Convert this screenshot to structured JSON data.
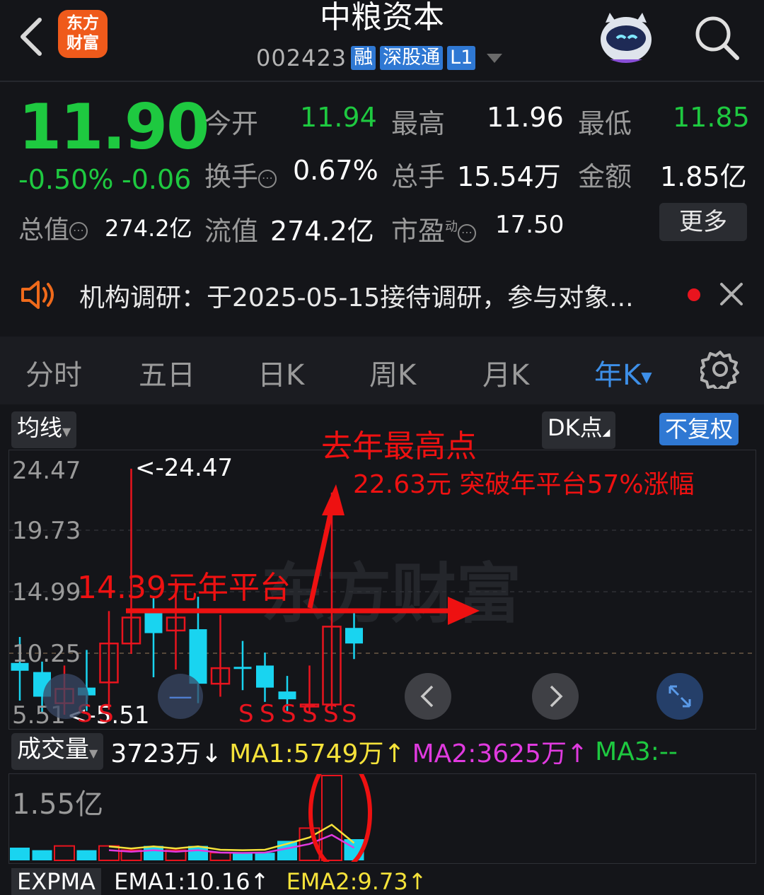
{
  "header": {
    "title": "中粮资本",
    "logo_line1": "东方",
    "logo_line2": "财富",
    "code": "002423",
    "tags": [
      "融",
      "深股通",
      "L1"
    ]
  },
  "quote": {
    "price": "11.90",
    "change_pct": "-0.50%",
    "change_amt": "-0.06",
    "fields": {
      "open_label": "今开",
      "open_value": "11.94",
      "high_label": "最高",
      "high_value": "11.96",
      "low_label": "最低",
      "low_value": "11.85",
      "turnover_label": "换手",
      "turnover_value": "0.67%",
      "volume_label": "总手",
      "volume_value": "15.54万",
      "amount_label": "金额",
      "amount_value": "1.85亿",
      "mktcap_label": "总值",
      "mktcap_value": "274.2亿",
      "float_label": "流值",
      "float_value": "274.2亿",
      "pe_label": "市盈",
      "pe_sup": "动",
      "pe_value": "17.50"
    },
    "more_label": "更多"
  },
  "news": {
    "text": "机构调研：于2025-05-15接待调研，参与对象..."
  },
  "tabs": [
    {
      "label": "分时"
    },
    {
      "label": "五日"
    },
    {
      "label": "日K"
    },
    {
      "label": "周K"
    },
    {
      "label": "月K"
    },
    {
      "label": "年K"
    }
  ],
  "chart_toolbar": {
    "ma_label": "均线",
    "dk_label": "DK点",
    "adjust_label": "不复权"
  },
  "chart_data": {
    "type": "candlestick",
    "y_ticks": [
      "24.47",
      "19.73",
      "14.99",
      "10.25",
      "5.51"
    ],
    "ylim": [
      5.51,
      24.47
    ],
    "max_label": "<-24.47",
    "min_label": "<-5.51",
    "watermark": "东方财富",
    "candles": [
      {
        "o": 9.5,
        "c": 8.9,
        "h": 11.5,
        "l": 6.6,
        "dir": "down"
      },
      {
        "o": 8.8,
        "c": 6.9,
        "h": 9.6,
        "l": 5.7,
        "dir": "down"
      },
      {
        "o": 6.4,
        "c": 7.5,
        "h": 9.3,
        "l": 5.51,
        "dir": "up"
      },
      {
        "o": 7.6,
        "c": 7.0,
        "h": 10.5,
        "l": 5.8,
        "dir": "down"
      },
      {
        "o": 8.0,
        "c": 11.0,
        "h": 13.5,
        "l": 5.9,
        "dir": "up"
      },
      {
        "o": 11.0,
        "c": 13.0,
        "h": 24.47,
        "l": 10.2,
        "dir": "up"
      },
      {
        "o": 13.4,
        "c": 11.8,
        "h": 14.6,
        "l": 8.4,
        "dir": "down"
      },
      {
        "o": 12.0,
        "c": 13.0,
        "h": 16.0,
        "l": 9.0,
        "dir": "up"
      },
      {
        "o": 12.1,
        "c": 7.9,
        "h": 14.6,
        "l": 6.4,
        "dir": "down"
      },
      {
        "o": 7.9,
        "c": 9.1,
        "h": 13.2,
        "l": 6.9,
        "dir": "up"
      },
      {
        "o": 9.2,
        "c": 9.1,
        "h": 11.2,
        "l": 7.4,
        "dir": "down"
      },
      {
        "o": 9.3,
        "c": 7.6,
        "h": 10.3,
        "l": 6.5,
        "dir": "down"
      },
      {
        "o": 7.3,
        "c": 6.7,
        "h": 8.5,
        "l": 5.8,
        "dir": "down"
      },
      {
        "o": 6.2,
        "c": 6.3,
        "h": 9.3,
        "l": 5.6,
        "dir": "up"
      },
      {
        "o": 6.3,
        "c": 12.3,
        "h": 22.63,
        "l": 5.9,
        "dir": "up"
      },
      {
        "o": 12.2,
        "c": 11.0,
        "h": 13.4,
        "l": 9.8,
        "dir": "down"
      }
    ],
    "signal_label": "S",
    "annotations": {
      "platform": "14.39元年平台",
      "peak_title": "去年最高点",
      "peak_detail": "22.63元 突破年平台57%涨幅"
    },
    "volume": {
      "label": "成交量",
      "current": "3723万",
      "current_arrow": "↓",
      "ma1": "MA1:5749万",
      "ma1_arrow": "↑",
      "ma2": "MA2:3625万",
      "ma2_arrow": "↑",
      "ma3": "MA3:--",
      "max_label": "1.55亿",
      "bars": [
        0.15,
        0.12,
        0.17,
        0.12,
        0.17,
        0.12,
        0.17,
        0.12,
        0.17,
        0.09,
        0.08,
        0.09,
        0.23,
        0.38,
        1.0,
        0.25
      ],
      "bar_dirs": [
        "down",
        "down",
        "up",
        "down",
        "up",
        "up",
        "down",
        "up",
        "down",
        "up",
        "down",
        "down",
        "down",
        "up",
        "up",
        "down"
      ]
    },
    "colors": {
      "up": "#e8141e",
      "down": "#19d4f0",
      "ma1": "#f5e23a",
      "ma2": "#e03adf",
      "ma3": "#1ec940"
    }
  },
  "bottom": {
    "indicator": "EXPMA",
    "ema1": "EMA1:10.16",
    "ema1_arrow": "↑",
    "ema2": "EMA2:9.73",
    "ema2_arrow": "↑"
  }
}
